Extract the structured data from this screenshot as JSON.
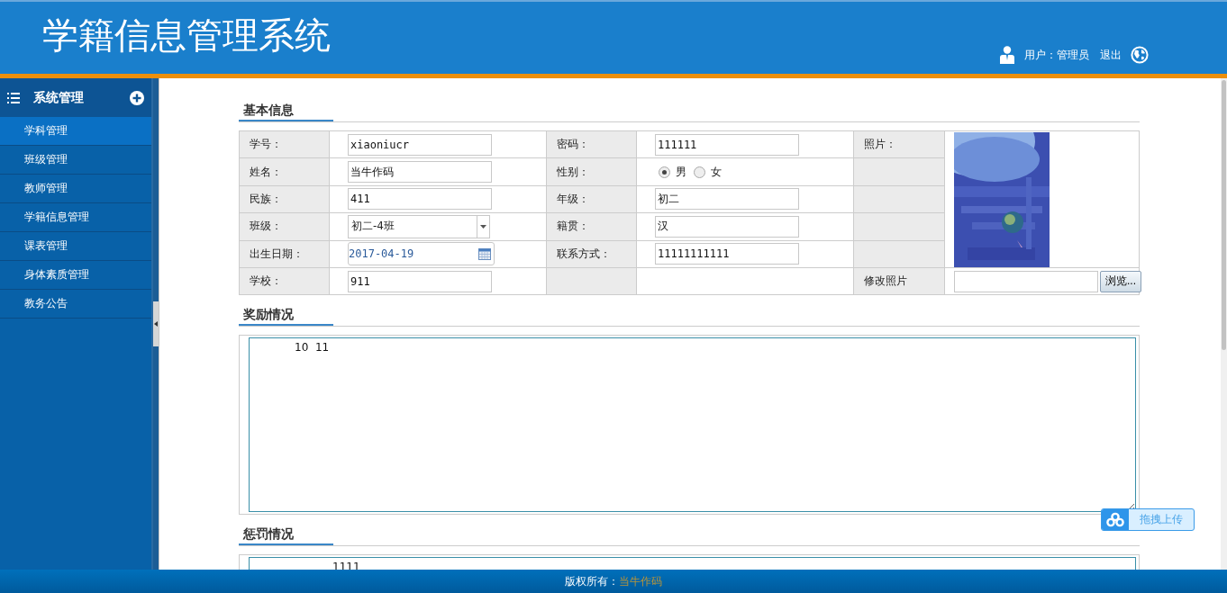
{
  "header": {
    "title": "学籍信息管理系统",
    "user": "用户：管理员",
    "logout": "退出"
  },
  "sidebar": {
    "title": "系统管理",
    "items": [
      {
        "label": "学科管理",
        "selected": true
      },
      {
        "label": "班级管理",
        "selected": false
      },
      {
        "label": "教师管理",
        "selected": false
      },
      {
        "label": "学籍信息管理",
        "selected": false
      },
      {
        "label": "课表管理",
        "selected": false
      },
      {
        "label": "身体素质管理",
        "selected": false
      },
      {
        "label": "教务公告",
        "selected": false
      }
    ]
  },
  "basic_info": {
    "title": "基本信息",
    "rows": [
      {
        "fields": [
          {
            "label": "学号：",
            "kind": "text",
            "value": "xiaoniucr"
          },
          {
            "label": "密码：",
            "kind": "text",
            "value": "111111"
          }
        ]
      },
      {
        "fields": [
          {
            "label": "姓名：",
            "kind": "text",
            "value": "当牛作码"
          },
          {
            "label": "性别：",
            "kind": "radio",
            "options": [
              {
                "label": "男",
                "selected": true
              },
              {
                "label": "女",
                "selected": false
              }
            ]
          }
        ]
      },
      {
        "fields": [
          {
            "label": "民族：",
            "kind": "text",
            "value": "411"
          },
          {
            "label": "年级：",
            "kind": "text",
            "value": "初二"
          }
        ]
      },
      {
        "fields": [
          {
            "label": "班级：",
            "kind": "select",
            "value": "初二-4班"
          },
          {
            "label": "籍贯：",
            "kind": "text",
            "value": "汉"
          }
        ]
      },
      {
        "fields": [
          {
            "label": "出生日期：",
            "kind": "date",
            "value": "2017-04-19"
          },
          {
            "label": "联系方式：",
            "kind": "text",
            "value": "11111111111"
          }
        ]
      },
      {
        "fields": [
          {
            "label": "学校：",
            "kind": "text",
            "value": "911"
          }
        ]
      }
    ],
    "photo": {
      "label": "照片：",
      "kind": "picture"
    },
    "change_photo": {
      "label": "修改照片",
      "button": "浏览..."
    }
  },
  "awards": {
    "title": "奖励情况",
    "text": "10  11"
  },
  "punishments": {
    "title": "惩罚情况",
    "text": "1111"
  },
  "upload_button": {
    "label": "拖拽上传"
  },
  "footer": {
    "label": "版权所有：",
    "owner": "当牛作码"
  }
}
